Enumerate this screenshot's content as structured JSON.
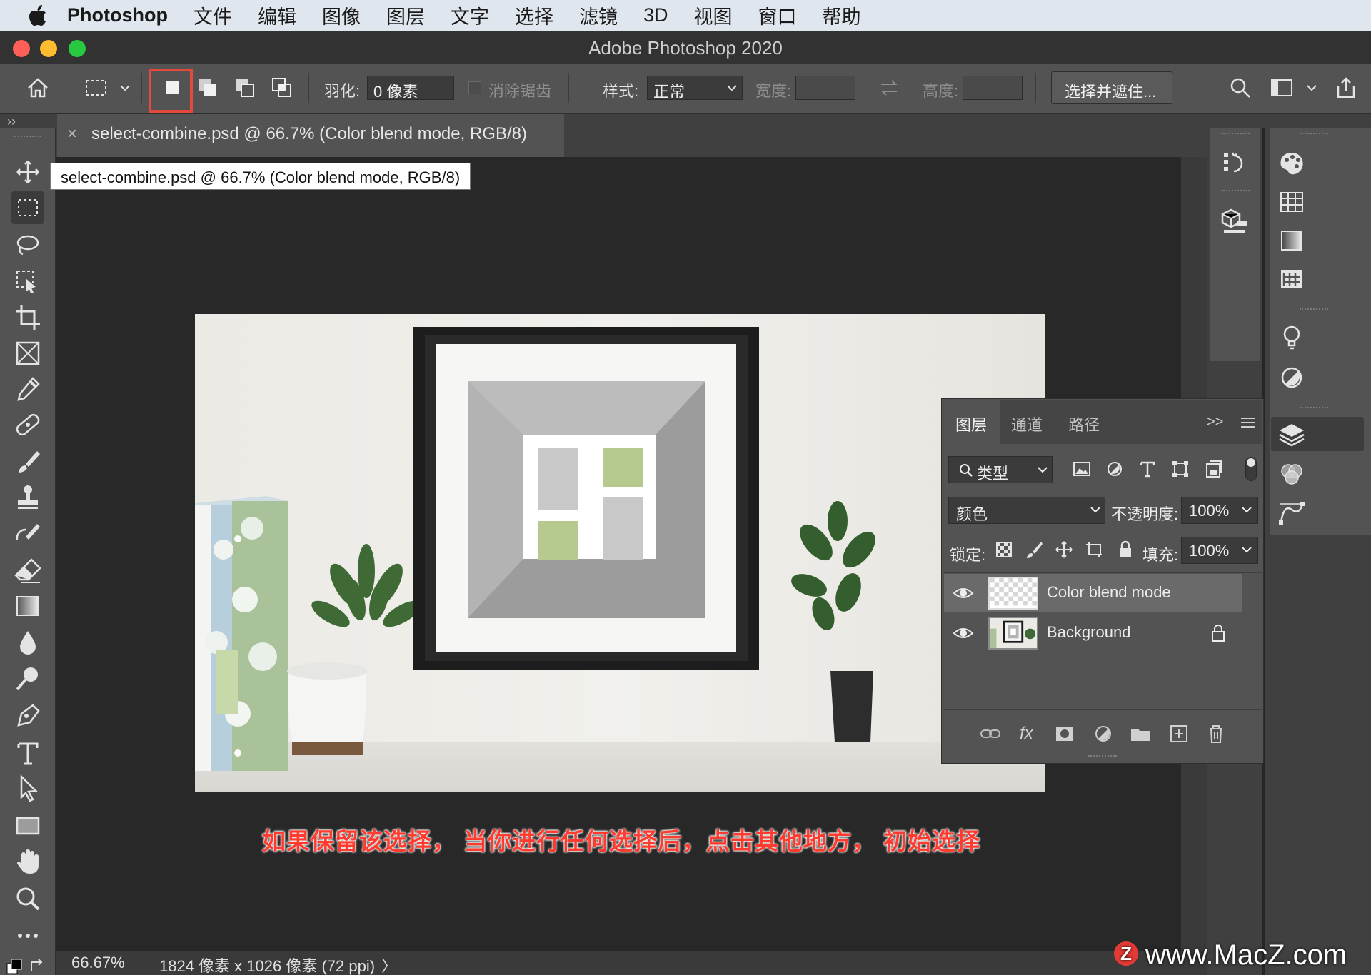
{
  "menubar": {
    "app_name": "Photoshop",
    "items": [
      "文件",
      "编辑",
      "图像",
      "图层",
      "文字",
      "选择",
      "滤镜",
      "3D",
      "视图",
      "窗口",
      "帮助"
    ]
  },
  "window": {
    "title": "Adobe Photoshop 2020"
  },
  "options": {
    "feather_label": "羽化:",
    "feather_value": "0 像素",
    "antialias_label": "消除锯齿",
    "style_label": "样式:",
    "style_value": "正常",
    "width_label": "宽度:",
    "height_label": "高度:",
    "select_mask_label": "选择并遮住..."
  },
  "document": {
    "tab_title": "select-combine.psd @ 66.7% (Color blend mode, RGB/8)",
    "tooltip": "select-combine.psd @ 66.7% (Color blend mode, RGB/8)",
    "close_glyph": "×"
  },
  "layers_panel": {
    "tabs": [
      "图层",
      "通道",
      "路径"
    ],
    "filter_label": "类型",
    "blend_mode": "颜色",
    "opacity_label": "不透明度:",
    "opacity_value": "100%",
    "lock_label": "锁定:",
    "fill_label": "填充:",
    "fill_value": "100%",
    "layers": [
      {
        "name": "Color blend mode",
        "selected": true,
        "locked": false
      },
      {
        "name": "Background",
        "selected": false,
        "locked": true
      }
    ],
    "fx_label": "fx"
  },
  "subtitle": "如果保留该选择， 当你进行任何选择后，点击其他地方， 初始选择",
  "status": {
    "zoom": "66.67%",
    "dimensions": "1824 像素 x 1026 像素 (72 ppi)",
    "chevron": "〉"
  },
  "watermark": {
    "glyph": "Z",
    "text": "www.MacZ.com"
  },
  "colors": {
    "accent_highlight": "#e5483d",
    "canvas_bg": "#282828",
    "panel_bg": "#535353"
  }
}
